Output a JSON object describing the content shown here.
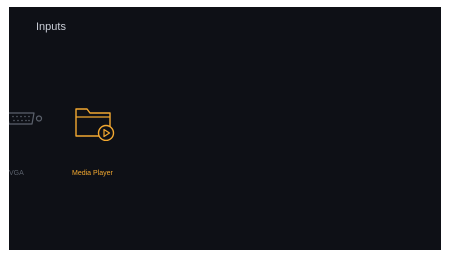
{
  "screen": {
    "title": "Inputs",
    "background_color": "#0e1016",
    "accent_color": "#f2a830",
    "inputs": [
      {
        "label": "VGA",
        "icon": "vga-port-icon",
        "selected": false
      },
      {
        "label": "Media Player",
        "icon": "folder-play-icon",
        "selected": true
      }
    ]
  }
}
